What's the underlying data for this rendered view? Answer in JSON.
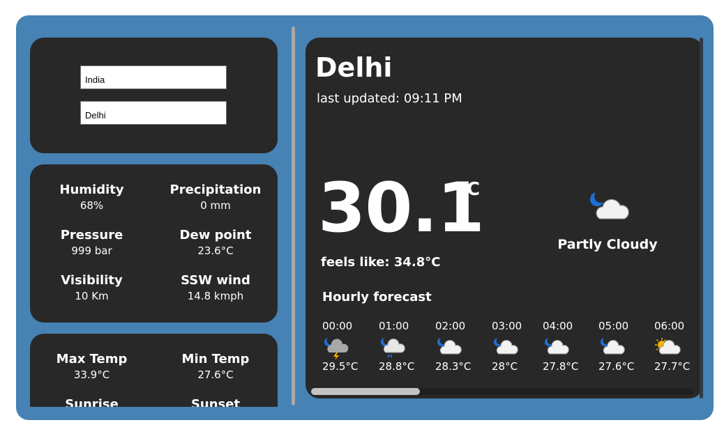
{
  "search": {
    "country_value": "India",
    "city_value": "Delhi"
  },
  "stats": [
    {
      "label": "Humidity",
      "value": "68%"
    },
    {
      "label": "Precipitation",
      "value": "0 mm"
    },
    {
      "label": "Pressure",
      "value": "999 bar"
    },
    {
      "label": "Dew point",
      "value": "23.6°C"
    },
    {
      "label": "Visibility",
      "value": "10 Km"
    },
    {
      "label": "SSW wind",
      "value": "14.8 kmph"
    }
  ],
  "temps": [
    {
      "label": "Max Temp",
      "value": "33.9°C"
    },
    {
      "label": "Min Temp",
      "value": "27.6°C"
    },
    {
      "label": "Sunrise",
      "value": ""
    },
    {
      "label": "Sunset",
      "value": ""
    }
  ],
  "current": {
    "city": "Delhi",
    "last_updated": "last updated: 09:11 PM",
    "temperature": "30.1",
    "unit": "°C",
    "feels_like": "feels like: 34.8°C",
    "condition": "Partly Cloudy",
    "condition_icon": "partly-cloudy-night-icon"
  },
  "hourly": {
    "title": "Hourly forecast",
    "items": [
      {
        "time": "00:00",
        "temp": "29.5°C",
        "icon": "thunderstorm-night-icon"
      },
      {
        "time": "01:00",
        "temp": "28.8°C",
        "icon": "light-rain-night-icon"
      },
      {
        "time": "02:00",
        "temp": "28.3°C",
        "icon": "partly-cloudy-night-icon"
      },
      {
        "time": "03:00",
        "temp": "28°C",
        "icon": "partly-cloudy-night-icon"
      },
      {
        "time": "04:00",
        "temp": "27.8°C",
        "icon": "partly-cloudy-night-icon"
      },
      {
        "time": "05:00",
        "temp": "27.6°C",
        "icon": "partly-cloudy-night-icon"
      },
      {
        "time": "06:00",
        "temp": "27.7°C",
        "icon": "partly-cloudy-day-icon"
      }
    ]
  },
  "colors": {
    "background": "#4682b4",
    "panel": "#282828",
    "text": "#ffffff"
  }
}
